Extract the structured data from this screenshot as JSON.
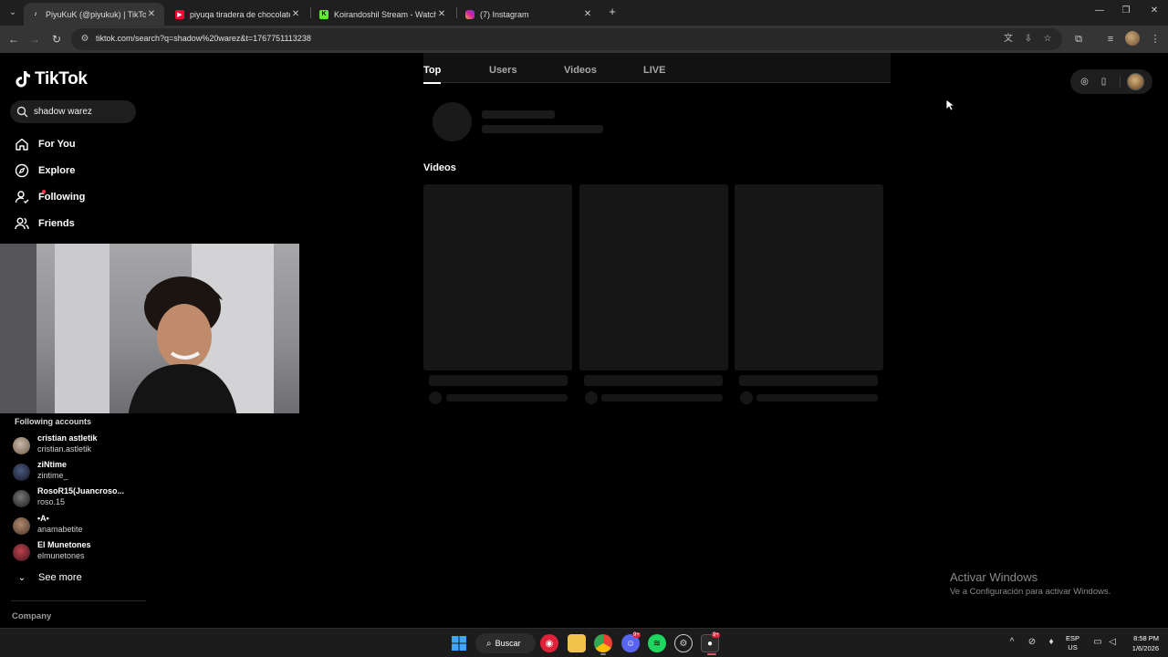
{
  "browser": {
    "tabs": [
      {
        "title": "PiyuKuK (@piyukuk) | TikTok",
        "favicon": "tiktok-icon",
        "active": true
      },
      {
        "title": "piyuqa tiradera de chocolate - Y",
        "favicon": "youtube-icon",
        "active": false
      },
      {
        "title": "Koirandoshil Stream - Watch Li",
        "favicon": "kick-icon",
        "active": false
      },
      {
        "title": "(7) Instagram",
        "favicon": "instagram-icon",
        "active": false
      }
    ],
    "url": "tiktok.com/search?q=shadow%20warez&t=1767751113238"
  },
  "sidebar": {
    "logo_text": "TikTok",
    "search_value": "shadow warez",
    "nav": [
      {
        "label": "For You",
        "icon": "home-icon"
      },
      {
        "label": "Explore",
        "icon": "compass-icon"
      },
      {
        "label": "Following",
        "icon": "following-icon"
      },
      {
        "label": "Friends",
        "icon": "friends-icon"
      }
    ],
    "following_title": "Following accounts",
    "accounts": [
      {
        "name": "cristian astletik",
        "handle": "cristian.astletik"
      },
      {
        "name": "ziNtime",
        "handle": "zintime_"
      },
      {
        "name": "RosoR15(Juancroso...",
        "handle": "roso.15"
      },
      {
        "name": "•A•",
        "handle": "anamabetite"
      },
      {
        "name": "El Munetones",
        "handle": "elmunetones"
      }
    ],
    "see_more": "See more",
    "company": "Company"
  },
  "main": {
    "tabs": [
      "Top",
      "Users",
      "Videos",
      "LIVE"
    ],
    "active_tab": "Top",
    "videos_heading": "Videos"
  },
  "watermark": {
    "line1": "Activar Windows",
    "line2": "Ve a Configuración para activar Windows."
  },
  "taskbar": {
    "search_label": "Buscar",
    "lang_line1": "ESP",
    "lang_line2": "US",
    "time": "8:58 PM",
    "date": "1/6/2026",
    "discord_badge": "9+",
    "obs_badge": "9+"
  },
  "colors": {
    "accent": "#fe2c55",
    "background": "#000000",
    "skeleton": "#161616"
  }
}
